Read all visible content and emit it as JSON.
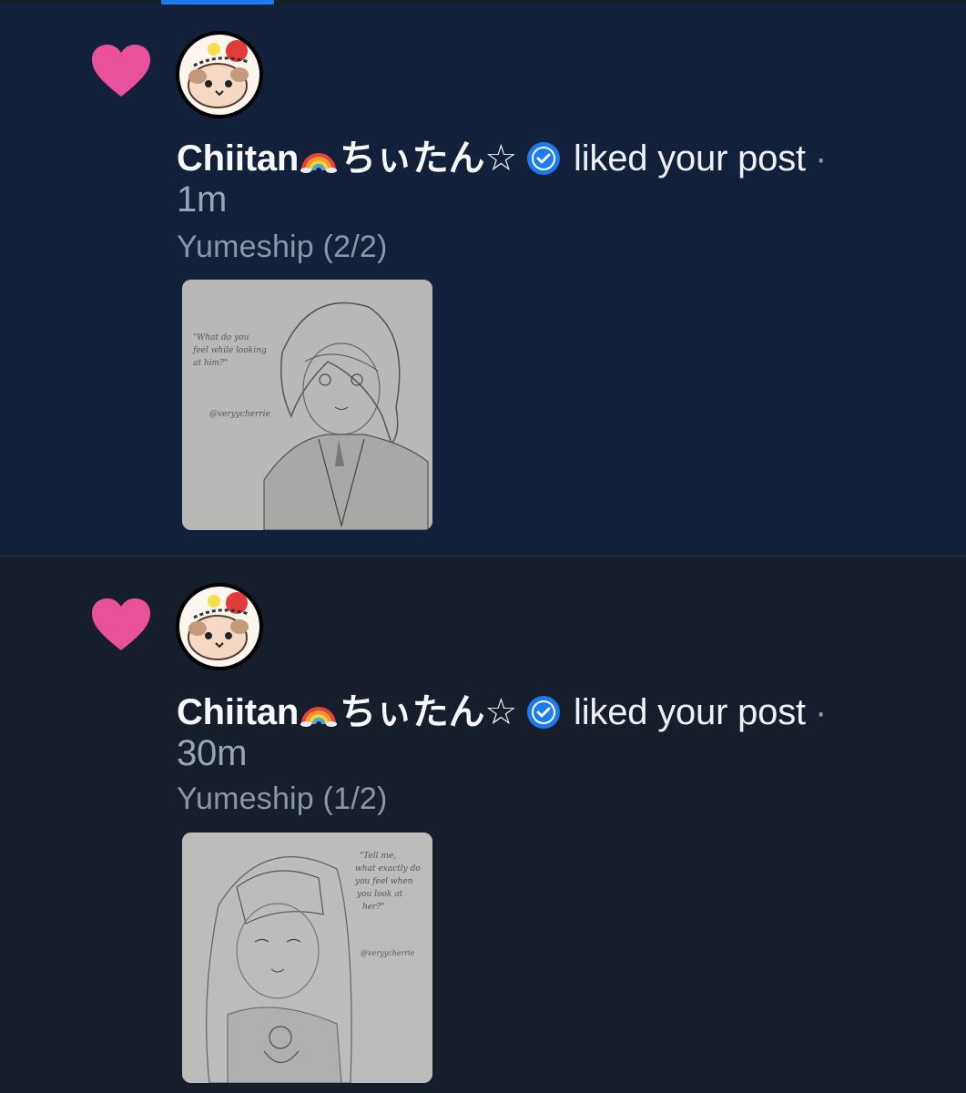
{
  "tab_indicator_color": "#1d7bf0",
  "notifications": [
    {
      "state": "unread",
      "icon": "heart-icon",
      "user_name": "Chiitan",
      "user_name_suffix": "ちぃたん☆",
      "rainbow_emoji": "rainbow-emoji",
      "verified": "verified-badge-icon",
      "action": "liked your post",
      "separator": "·",
      "time": "1m",
      "post_title": "Yumeship (2/2)",
      "image_caption": "\"What do you feel while looking at him?\"",
      "image_signature": "@veryycherrie"
    },
    {
      "state": "read",
      "icon": "heart-icon",
      "user_name": "Chiitan",
      "user_name_suffix": "ちぃたん☆",
      "rainbow_emoji": "rainbow-emoji",
      "verified": "verified-badge-icon",
      "action": "liked your post",
      "separator": "·",
      "time": "30m",
      "post_title": "Yumeship (1/2)",
      "image_caption": "\"Tell me, what exactly do you feel when you look at her?\"",
      "image_signature": "@veryycherrie"
    }
  ],
  "colors": {
    "heart": "#e9519a",
    "unread_bg": "#12203a",
    "read_bg": "#161e2b",
    "verified": "#1d7bf0"
  }
}
